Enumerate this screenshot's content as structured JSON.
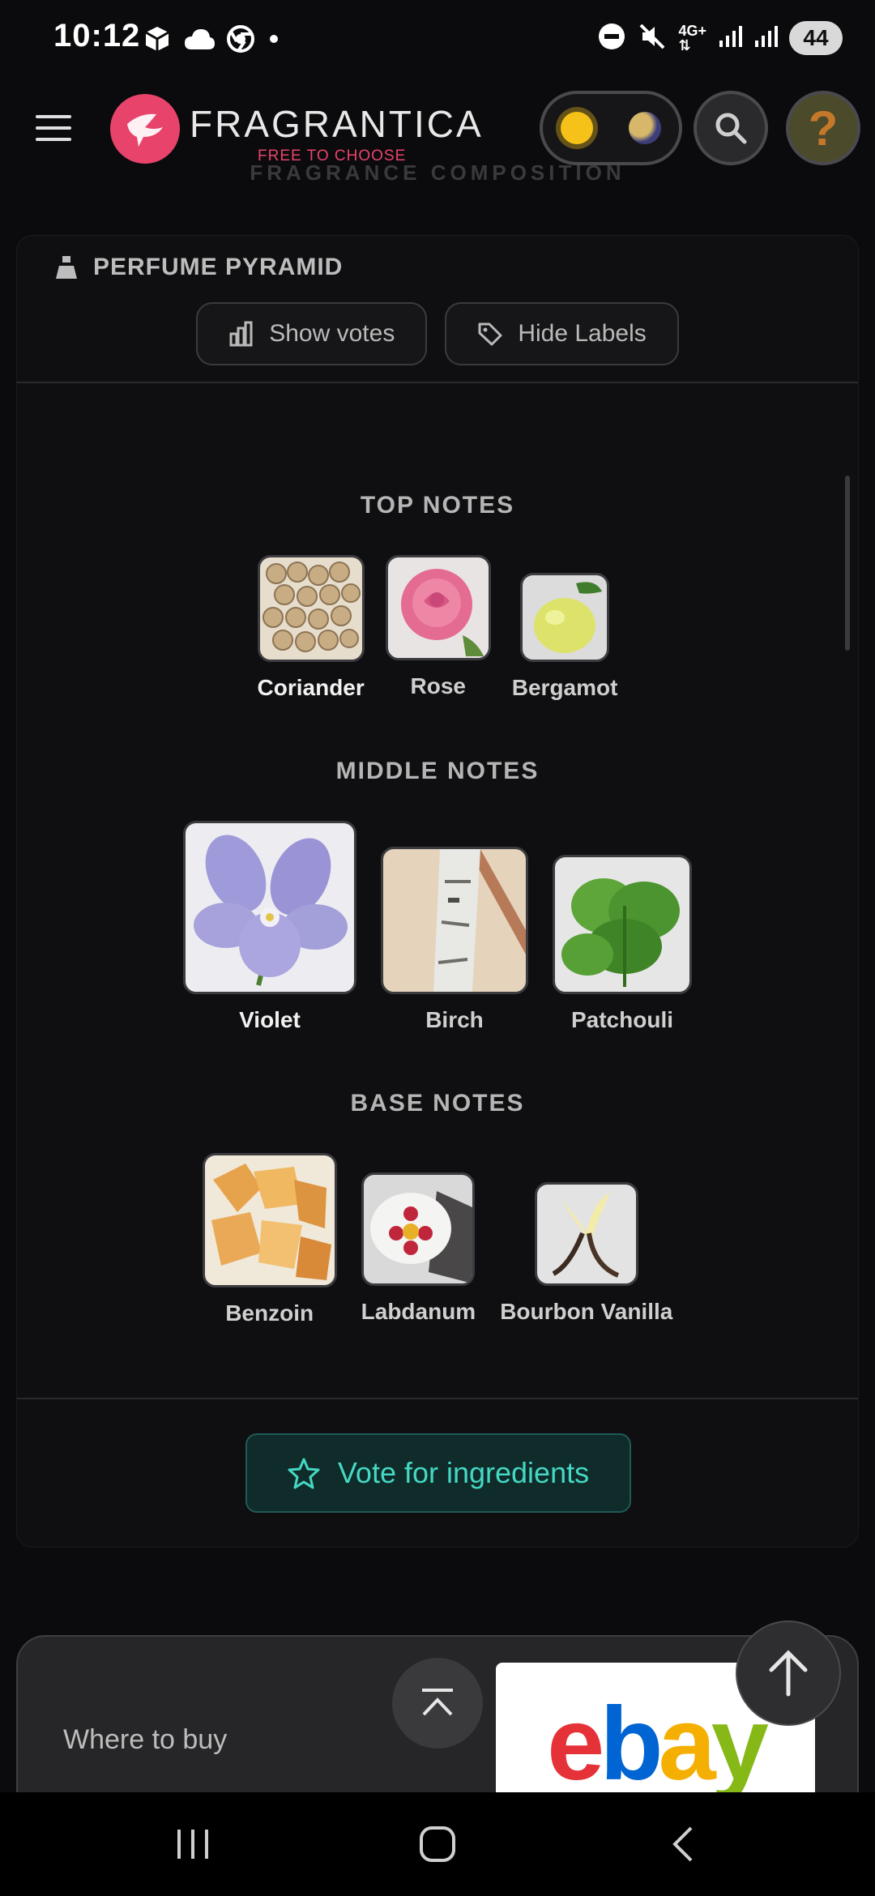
{
  "status_bar": {
    "time": "10:12",
    "battery": "44"
  },
  "header": {
    "logo_text": "FRAGRANTICA",
    "tagline": "FREE TO CHOOSE"
  },
  "section_heading": "FRAGRANCE COMPOSITION",
  "pyramid": {
    "title": "PERFUME PYRAMID",
    "show_votes": "Show votes",
    "hide_labels": "Hide Labels",
    "tiers": [
      {
        "title": "TOP NOTES",
        "notes": [
          {
            "name": "Coriander",
            "icon": "coriander-seeds"
          },
          {
            "name": "Rose",
            "icon": "pink-rose"
          },
          {
            "name": "Bergamot",
            "icon": "bergamot-fruit"
          }
        ]
      },
      {
        "title": "MIDDLE NOTES",
        "notes": [
          {
            "name": "Violet",
            "icon": "violet-flower"
          },
          {
            "name": "Birch",
            "icon": "birch-branch"
          },
          {
            "name": "Patchouli",
            "icon": "patchouli-leaves"
          }
        ]
      },
      {
        "title": "BASE NOTES",
        "notes": [
          {
            "name": "Benzoin",
            "icon": "benzoin-resin"
          },
          {
            "name": "Labdanum",
            "icon": "labdanum-flower"
          },
          {
            "name": "Bourbon Vanilla",
            "icon": "vanilla-pod"
          }
        ]
      }
    ],
    "vote_button": "Vote for ingredients"
  },
  "where_to_buy": {
    "label": "Where to buy",
    "logo": "ebay"
  },
  "colors": {
    "brand_pink": "#e8436b",
    "accent_teal": "#45d8c3"
  }
}
